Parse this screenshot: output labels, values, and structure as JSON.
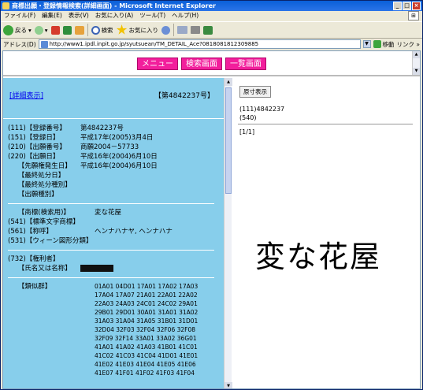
{
  "window": {
    "title": "商標出願・登録情報検索(詳細画面) - Microsoft Internet Explorer"
  },
  "menu": [
    "ファイル(F)",
    "編集(E)",
    "表示(V)",
    "お気に入り(A)",
    "ツール(T)",
    "ヘルプ(H)"
  ],
  "toolbar": {
    "back": "戻る",
    "search": "検索",
    "favorites": "お気に入り"
  },
  "address": {
    "label": "アドレス(D)",
    "url": "http://www1.ipdl.inpit.go.jp/syutsuean/TM_DETAIL_Ace?0818081812309885",
    "go": "移動",
    "links": "リンク »"
  },
  "nav": {
    "menu": "メニュー",
    "search_screen": "検索画面",
    "list_screen": "一覧画面"
  },
  "left": {
    "detail_link": "[詳細表示]",
    "reg_head": "【第4842237号】",
    "rows1": [
      {
        "k": "(111)【登録番号】",
        "v": "第4842237号"
      },
      {
        "k": "(151)【登録日】",
        "v": "平成17年(2005)3月4日"
      },
      {
        "k": "(210)【出願番号】",
        "v": "商願2004－57733"
      },
      {
        "k": "(220)【出願日】",
        "v": "平成16年(2004)6月10日"
      },
      {
        "k": "　　【先願権発生日】",
        "v": "平成16年(2004)6月10日"
      },
      {
        "k": "　　【最終処分日】",
        "v": ""
      },
      {
        "k": "　　【最終処分種別】",
        "v": ""
      },
      {
        "k": "　　【出願種別】",
        "v": ""
      }
    ],
    "rows2": [
      {
        "k": "　　【商標(検索用)】",
        "v": "変な花屋"
      },
      {
        "k": "(541)【標準文字商標】",
        "v": ""
      },
      {
        "k": "(561)【称呼】",
        "v": "ヘンナハナヤ, ヘンナハナ"
      },
      {
        "k": "(531)【ウィーン図形分類】",
        "v": ""
      }
    ],
    "owner_head": "(732)【権利者】",
    "owner_name_key": "　　【氏名又は名称】",
    "similar_key": "　　【類似群】",
    "similar": [
      "01A01 04D01 17A01 17A02 17A03",
      "17A04 17A07 21A01 22A01 22A02",
      "22A03 24A03 24C01 24C02 29A01",
      "29B01 29D01 30A01 31A01 31A02",
      "31A03 31A04 31A05 31B01 31D01",
      "32D04 32F03 32F04 32F06 32F08",
      "32F09 32F14 33A01 33A02 36G01",
      "41A01 41A02 41A03 41B01 41C01",
      "41C02 41C03 41C04 41D01 41E01",
      "41E02 41E03 41E04 41E05 41E06",
      "41E07 41F01 41F02 41F03 41F04"
    ]
  },
  "right": {
    "orig_button": "原寸表示",
    "reg": "(111)4842237",
    "code": "(540)",
    "pager": "[1/1]",
    "mark": "変な花屋"
  }
}
